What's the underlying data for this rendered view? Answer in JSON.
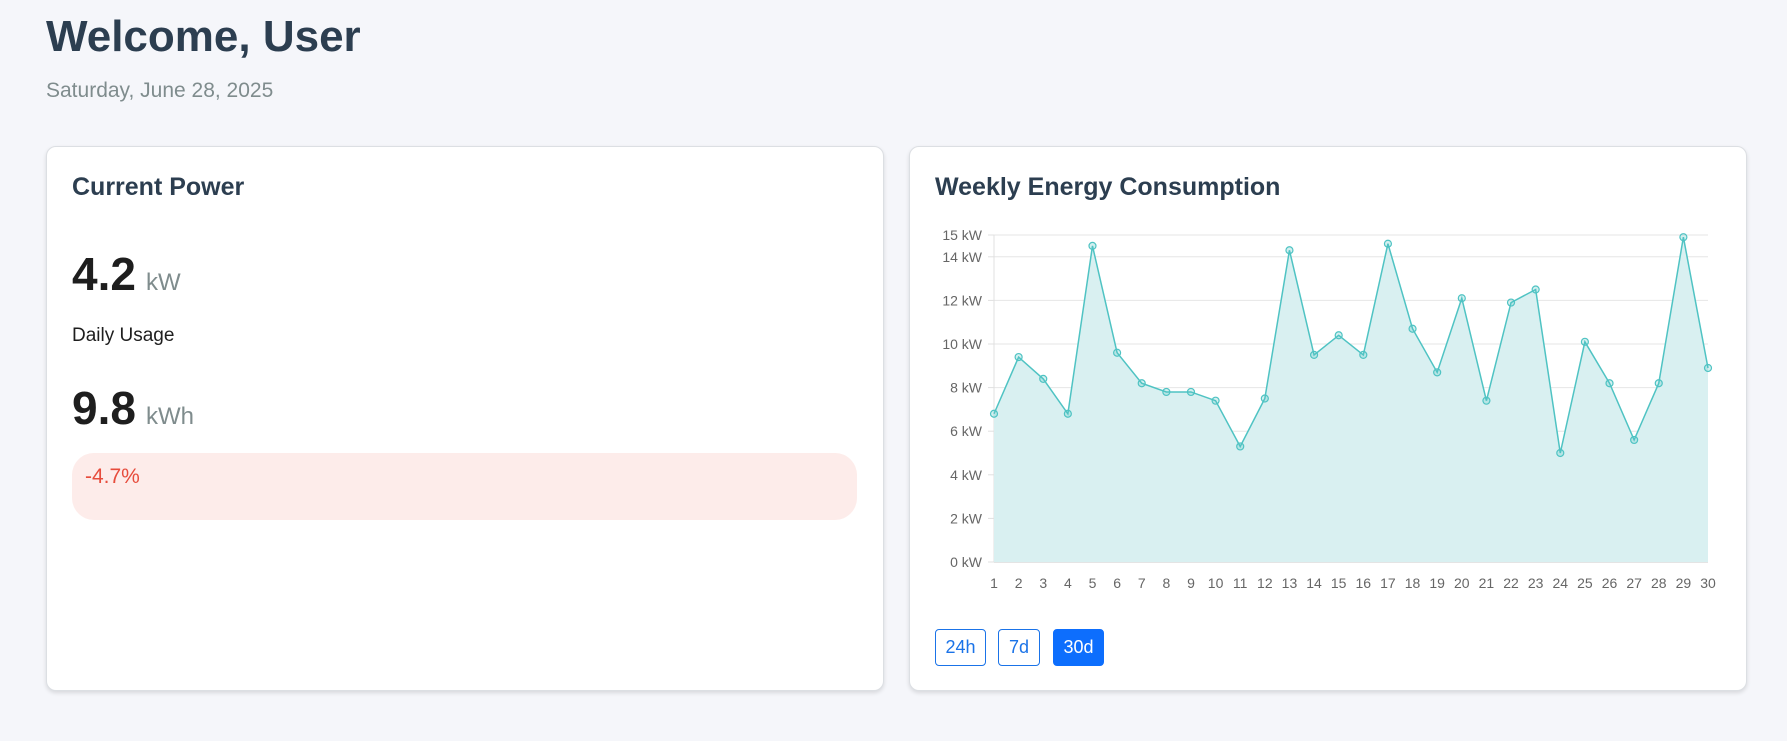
{
  "header": {
    "title": "Welcome, User",
    "date": "Saturday, June 28, 2025"
  },
  "power_card": {
    "title": "Current Power",
    "current_value": "4.2",
    "current_unit": "kW",
    "daily_label": "Daily Usage",
    "daily_value": "9.8",
    "daily_unit": "kWh",
    "change": "-4.7%"
  },
  "energy_card": {
    "title": "Weekly Energy Consumption",
    "range_buttons": [
      {
        "label": "24h",
        "active": false
      },
      {
        "label": "7d",
        "active": false
      },
      {
        "label": "30d",
        "active": true
      }
    ]
  },
  "colors": {
    "line": "#4fc3c3",
    "fill": "#d9f0f1",
    "accent": "#0d6efd",
    "negative": "#e74c3c"
  },
  "chart_data": {
    "type": "area",
    "title": "Weekly Energy Consumption",
    "categories": [
      "1",
      "2",
      "3",
      "4",
      "5",
      "6",
      "7",
      "8",
      "9",
      "10",
      "11",
      "12",
      "13",
      "14",
      "15",
      "16",
      "17",
      "18",
      "19",
      "20",
      "21",
      "22",
      "23",
      "24",
      "25",
      "26",
      "27",
      "28",
      "29",
      "30"
    ],
    "series": [
      {
        "values": [
          6.8,
          9.4,
          8.4,
          6.8,
          14.5,
          9.6,
          8.2,
          7.8,
          7.8,
          7.4,
          5.3,
          7.5,
          14.3,
          9.5,
          10.4,
          9.5,
          14.6,
          10.7,
          8.7,
          12.1,
          7.4,
          11.9,
          12.5,
          5.0,
          10.1,
          8.2,
          5.6,
          8.2,
          14.9,
          8.9
        ]
      }
    ],
    "y_ticks": [
      "0 kW",
      "2 kW",
      "4 kW",
      "6 kW",
      "8 kW",
      "10 kW",
      "12 kW",
      "14 kW",
      "15 kW"
    ],
    "y_tick_values": [
      0,
      2,
      4,
      6,
      8,
      10,
      12,
      14,
      15
    ],
    "ylim": [
      0,
      15
    ],
    "grid": true,
    "legend": "none"
  }
}
